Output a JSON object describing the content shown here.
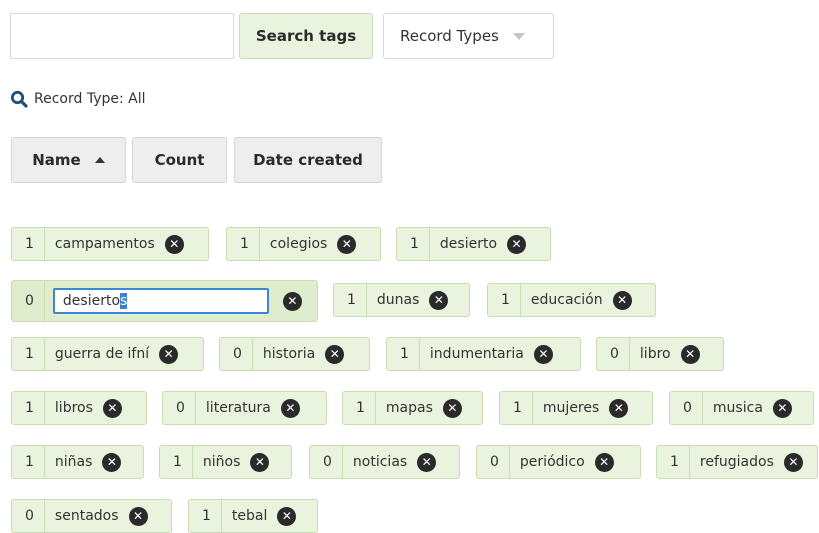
{
  "search": {
    "placeholder": "",
    "button_label": "Search tags"
  },
  "record_types": {
    "label": "Record Types"
  },
  "filter_status": "Record Type: All",
  "sort": {
    "name_label": "Name",
    "count_label": "Count",
    "date_label": "Date created",
    "active": "name-asc"
  },
  "tags": [
    {
      "count": "1",
      "name": "campamentos"
    },
    {
      "count": "1",
      "name": "colegios"
    },
    {
      "count": "1",
      "name": "desierto"
    },
    {
      "count": "0",
      "name": "desiertos",
      "editing": true,
      "edit_text": "desierto",
      "edit_selected": "s"
    },
    {
      "count": "1",
      "name": "dunas"
    },
    {
      "count": "1",
      "name": "educación"
    },
    {
      "count": "1",
      "name": "guerra de ifní"
    },
    {
      "count": "0",
      "name": "historia"
    },
    {
      "count": "1",
      "name": "indumentaria"
    },
    {
      "count": "0",
      "name": "libro"
    },
    {
      "count": "1",
      "name": "libros"
    },
    {
      "count": "0",
      "name": "literatura"
    },
    {
      "count": "1",
      "name": "mapas"
    },
    {
      "count": "1",
      "name": "mujeres"
    },
    {
      "count": "0",
      "name": "musica"
    },
    {
      "count": "1",
      "name": "niñas"
    },
    {
      "count": "1",
      "name": "niños"
    },
    {
      "count": "0",
      "name": "noticias"
    },
    {
      "count": "0",
      "name": "periódico"
    },
    {
      "count": "1",
      "name": "refugiados"
    },
    {
      "count": "0",
      "name": "sentados"
    },
    {
      "count": "1",
      "name": "tebal"
    }
  ],
  "colors": {
    "tag_bg": "#eaf3dd",
    "tag_border": "#c9ddb4",
    "focus": "#3b86d6",
    "delete_icon": "#2a2a2a"
  },
  "icons": {
    "search": "magnifier-icon",
    "delete": "circle-x-icon",
    "sort": "caret-up-icon",
    "dropdown": "caret-down-icon"
  }
}
